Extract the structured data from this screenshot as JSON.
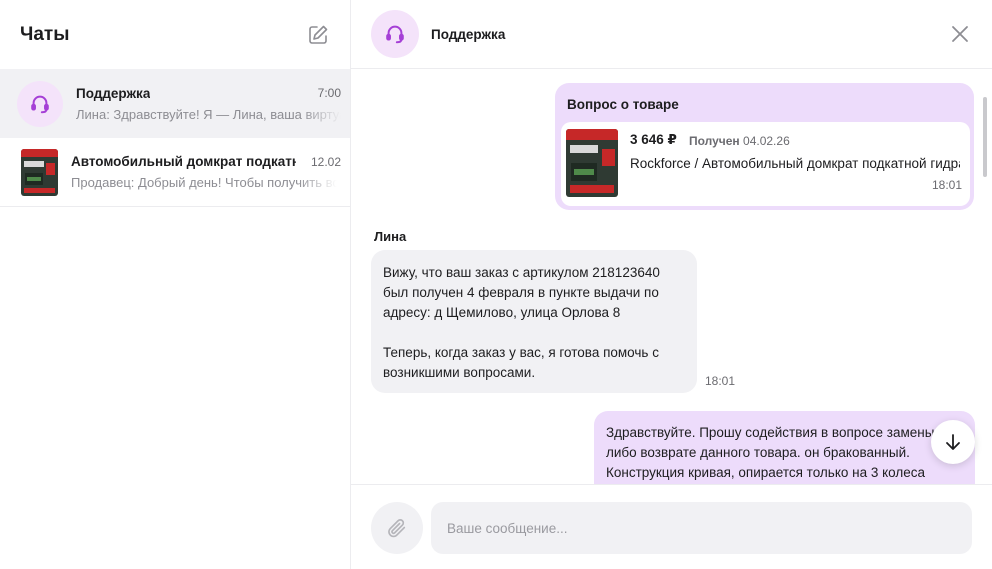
{
  "sidebar": {
    "title": "Чаты",
    "chats": [
      {
        "name": "Поддержка",
        "time": "7:00",
        "preview": "Лина: Здравствуйте! Я — Лина, ваша виртуальная помощница"
      },
      {
        "name": "Автомобильный домкрат подкатной",
        "time": "12.02",
        "preview": "Продавец: Добрый день! Чтобы получить возврат"
      }
    ]
  },
  "chat": {
    "title": "Поддержка",
    "question": {
      "title": "Вопрос о товаре",
      "price": "3 646 ₽",
      "received_label": "Получен",
      "received_date": "04.02.26",
      "product_name": "Rockforce / Автомобильный домкрат подкатной гидравлический",
      "time": "18:01"
    },
    "reply": {
      "sender": "Лина",
      "paragraph1": "Вижу, что ваш заказ с артикулом 218123640 был получен 4 февраля в пункте выдачи по адресу: д Щемилово, улица Орлова 8",
      "paragraph2": "Теперь, когда заказ у вас, я готова помочь с возникшими вопросами.",
      "time": "18:01"
    },
    "user_message": {
      "text": "Здравствуйте. Прошу содействия в вопросе замены либо возврате данного товара. он бракованный. Конструкция кривая, опирается только на 3 колеса"
    }
  },
  "composer": {
    "placeholder": "Ваше сообщение..."
  },
  "colors": {
    "accent": "#a53fd6",
    "outgoing_bubble": "#eddcfb",
    "incoming_bubble": "#f1f1f4"
  }
}
